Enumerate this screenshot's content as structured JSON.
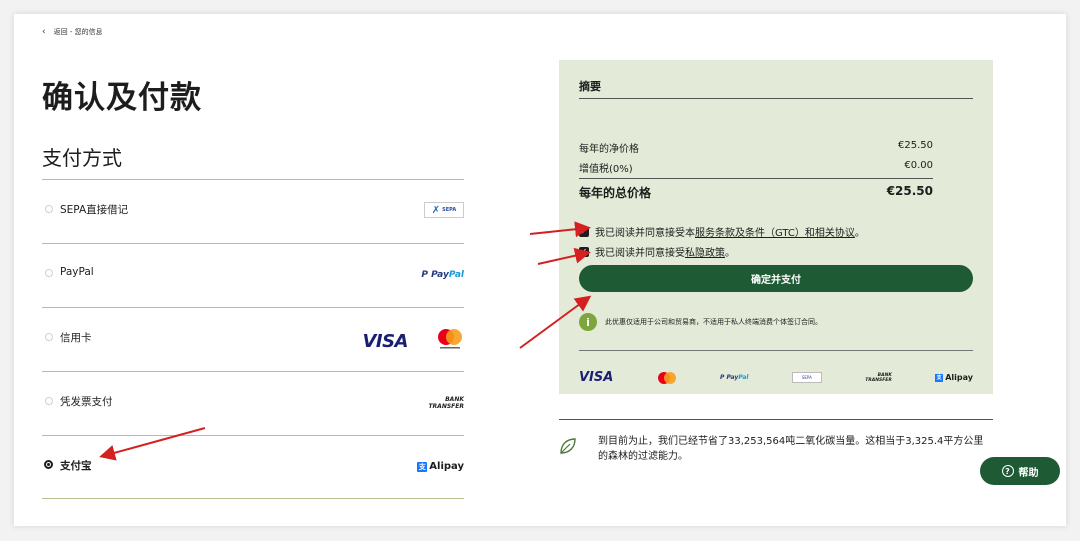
{
  "nav": {
    "back_icon": "chevron-left-icon",
    "back_label": "返回 - 您的信息"
  },
  "page": {
    "title": "确认及付款",
    "subtitle": "支付方式"
  },
  "methods": [
    {
      "label": "SEPA直接借记",
      "logo": "SEPA",
      "selected": false
    },
    {
      "label": "PayPal",
      "logo": "PayPal",
      "selected": false
    },
    {
      "label": "信用卡",
      "logo": "VISA",
      "selected": false
    },
    {
      "label": "凭发票支付",
      "logo": "BANK TRANSFER",
      "selected": false
    },
    {
      "label": "支付宝",
      "logo": "Alipay",
      "selected": true
    }
  ],
  "logos": {
    "sepa": "SEPA",
    "paypal_a": "Pay",
    "paypal_b": "Pal",
    "visa": "VISA",
    "bank_1": "BANK",
    "bank_2": "TRANSFER",
    "alipay": "Alipay",
    "alipay_mark": "支"
  },
  "summary": {
    "title": "摘要",
    "net_label": "每年的净价格",
    "net_value": "€25.50",
    "vat_label": "增值税(0%)",
    "vat_value": "€0.00",
    "total_label": "每年的总价格",
    "total_value": "€25.50",
    "check1_pre": "我已阅读并同意接受本",
    "check1_link": "服务条款及条件（GTC）和相关协议",
    "check1_post": "。",
    "check2_pre": "我已阅读并同意接受",
    "check2_link": "私隐政策",
    "check2_post": "。",
    "pay_button": "确定并支付",
    "info_icon": "i",
    "info_text": "此优惠仅适用于公司和贸易商，不适用于私人终端消费个体签订合同。"
  },
  "carbon": {
    "text_line1": "到目前为止，我们已经节省了33,253,564吨二氧化碳当量。这相当于3,325.4平方公里",
    "text_line2": "的森林的过滤能力。"
  },
  "help": {
    "label": "帮助",
    "icon": "?"
  },
  "colors": {
    "accent_green": "#1e5a34",
    "summary_bg": "#e3ebd8",
    "divider": "#b9c28f",
    "annotation_arrow": "#d42020"
  }
}
